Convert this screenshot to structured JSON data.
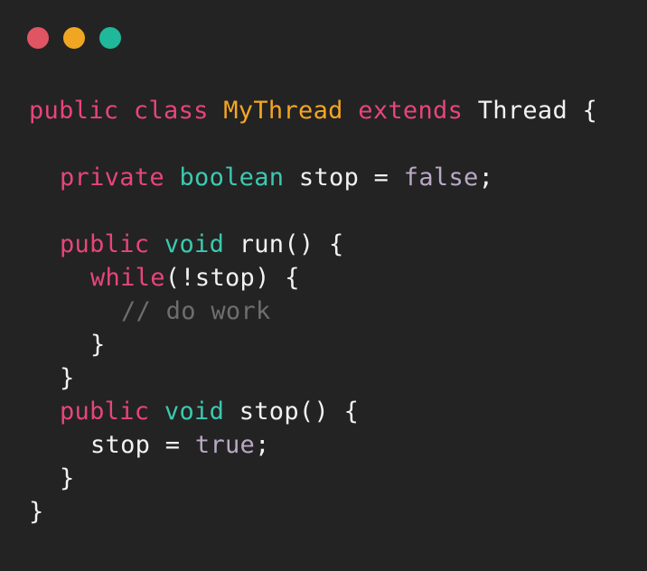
{
  "colors": {
    "background": "#232323",
    "dot_red": "#e05563",
    "dot_yellow": "#f0a623",
    "dot_green": "#1fb89a",
    "keyword_pink": "#e8457a",
    "type_teal": "#3cc9b0",
    "class_orange": "#f5a623",
    "plain_text": "#f2f2f2",
    "literal_purple": "#b9a9c6",
    "comment_gray": "#6e6e6e"
  },
  "window_controls": {
    "close_icon": "red-circle",
    "minimize_icon": "yellow-circle",
    "maximize_icon": "green-circle"
  },
  "code": {
    "lines": [
      {
        "indent": 0,
        "tokens": [
          {
            "text": "public",
            "role": "keyword_pink"
          },
          {
            "text": " ",
            "role": "plain_text"
          },
          {
            "text": "class",
            "role": "keyword_pink"
          },
          {
            "text": " ",
            "role": "plain_text"
          },
          {
            "text": "MyThread",
            "role": "class_orange"
          },
          {
            "text": " ",
            "role": "plain_text"
          },
          {
            "text": "extends",
            "role": "keyword_pink"
          },
          {
            "text": " Thread {",
            "role": "plain_text"
          }
        ]
      },
      {
        "indent": 0,
        "tokens": []
      },
      {
        "indent": 1,
        "tokens": [
          {
            "text": "private",
            "role": "keyword_pink"
          },
          {
            "text": " ",
            "role": "plain_text"
          },
          {
            "text": "boolean",
            "role": "type_teal"
          },
          {
            "text": " stop = ",
            "role": "plain_text"
          },
          {
            "text": "false",
            "role": "literal_purple"
          },
          {
            "text": ";",
            "role": "plain_text"
          }
        ]
      },
      {
        "indent": 0,
        "tokens": []
      },
      {
        "indent": 1,
        "tokens": [
          {
            "text": "public",
            "role": "keyword_pink"
          },
          {
            "text": " ",
            "role": "plain_text"
          },
          {
            "text": "void",
            "role": "type_teal"
          },
          {
            "text": " run() {",
            "role": "plain_text"
          }
        ]
      },
      {
        "indent": 2,
        "tokens": [
          {
            "text": "while",
            "role": "keyword_pink"
          },
          {
            "text": "(!stop) {",
            "role": "plain_text"
          }
        ]
      },
      {
        "indent": 3,
        "tokens": [
          {
            "text": "// do work",
            "role": "comment_gray"
          }
        ]
      },
      {
        "indent": 2,
        "tokens": [
          {
            "text": "}",
            "role": "plain_text"
          }
        ]
      },
      {
        "indent": 1,
        "tokens": [
          {
            "text": "}",
            "role": "plain_text"
          }
        ]
      },
      {
        "indent": 1,
        "tokens": [
          {
            "text": "public",
            "role": "keyword_pink"
          },
          {
            "text": " ",
            "role": "plain_text"
          },
          {
            "text": "void",
            "role": "type_teal"
          },
          {
            "text": " stop() {",
            "role": "plain_text"
          }
        ]
      },
      {
        "indent": 2,
        "tokens": [
          {
            "text": "stop = ",
            "role": "plain_text"
          },
          {
            "text": "true",
            "role": "literal_purple"
          },
          {
            "text": ";",
            "role": "plain_text"
          }
        ]
      },
      {
        "indent": 1,
        "tokens": [
          {
            "text": "}",
            "role": "plain_text"
          }
        ]
      },
      {
        "indent": 0,
        "tokens": [
          {
            "text": "}",
            "role": "plain_text"
          }
        ]
      }
    ]
  }
}
